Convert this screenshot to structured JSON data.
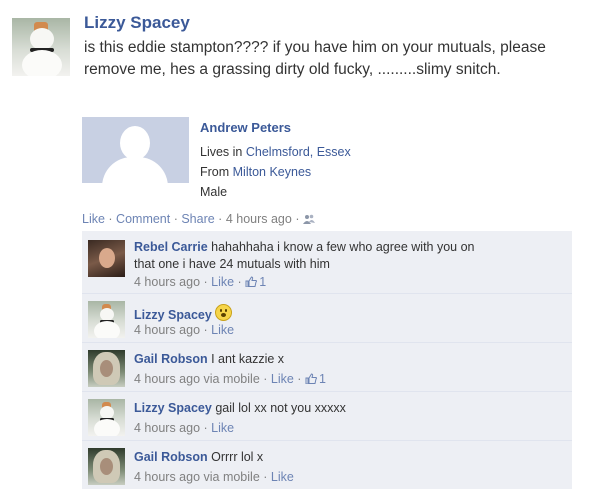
{
  "post": {
    "author": "Lizzy Spacey",
    "text": "is this eddie stampton???? if you have him on your mutuals, please remove me, hes a grassing dirty old fucky, .........slimy snitch."
  },
  "attachment": {
    "name": "Andrew Peters",
    "lives_prefix": "Lives in ",
    "lives_link": "Chelmsford, Essex",
    "from_prefix": "From ",
    "from_link": "Milton Keynes",
    "gender": "Male"
  },
  "actions": {
    "like": "Like",
    "comment": "Comment",
    "share": "Share",
    "time": "4 hours ago",
    "sep": " · "
  },
  "comments": [
    {
      "author": "Rebel Carrie",
      "line1": "hahahhaha i know a few who agree with you on",
      "line2": "that one i have 24 mutuals with him",
      "time": "4 hours ago",
      "like": "Like",
      "likes": "1"
    },
    {
      "author": "Lizzy Spacey",
      "text": "",
      "time": "4 hours ago",
      "like": "Like"
    },
    {
      "author": "Gail Robson",
      "text": "I ant kazzie x",
      "time": "4 hours ago via mobile",
      "like": "Like",
      "likes": "1"
    },
    {
      "author": "Lizzy Spacey",
      "text": "gail lol xx not you xxxxx",
      "time": "4 hours ago",
      "like": "Like"
    },
    {
      "author": "Gail Robson",
      "text": "Orrrr lol x",
      "time": "4 hours ago via mobile",
      "like": "Like"
    }
  ],
  "icons": {
    "thumb": "thumbs-up-icon",
    "friends": "friends-audience-icon",
    "smiley": "smiley-emoticon-icon"
  },
  "colors": {
    "name_blue": "#3b5998",
    "link_blue": "#6d84b4",
    "comment_bg": "#edeff4"
  }
}
